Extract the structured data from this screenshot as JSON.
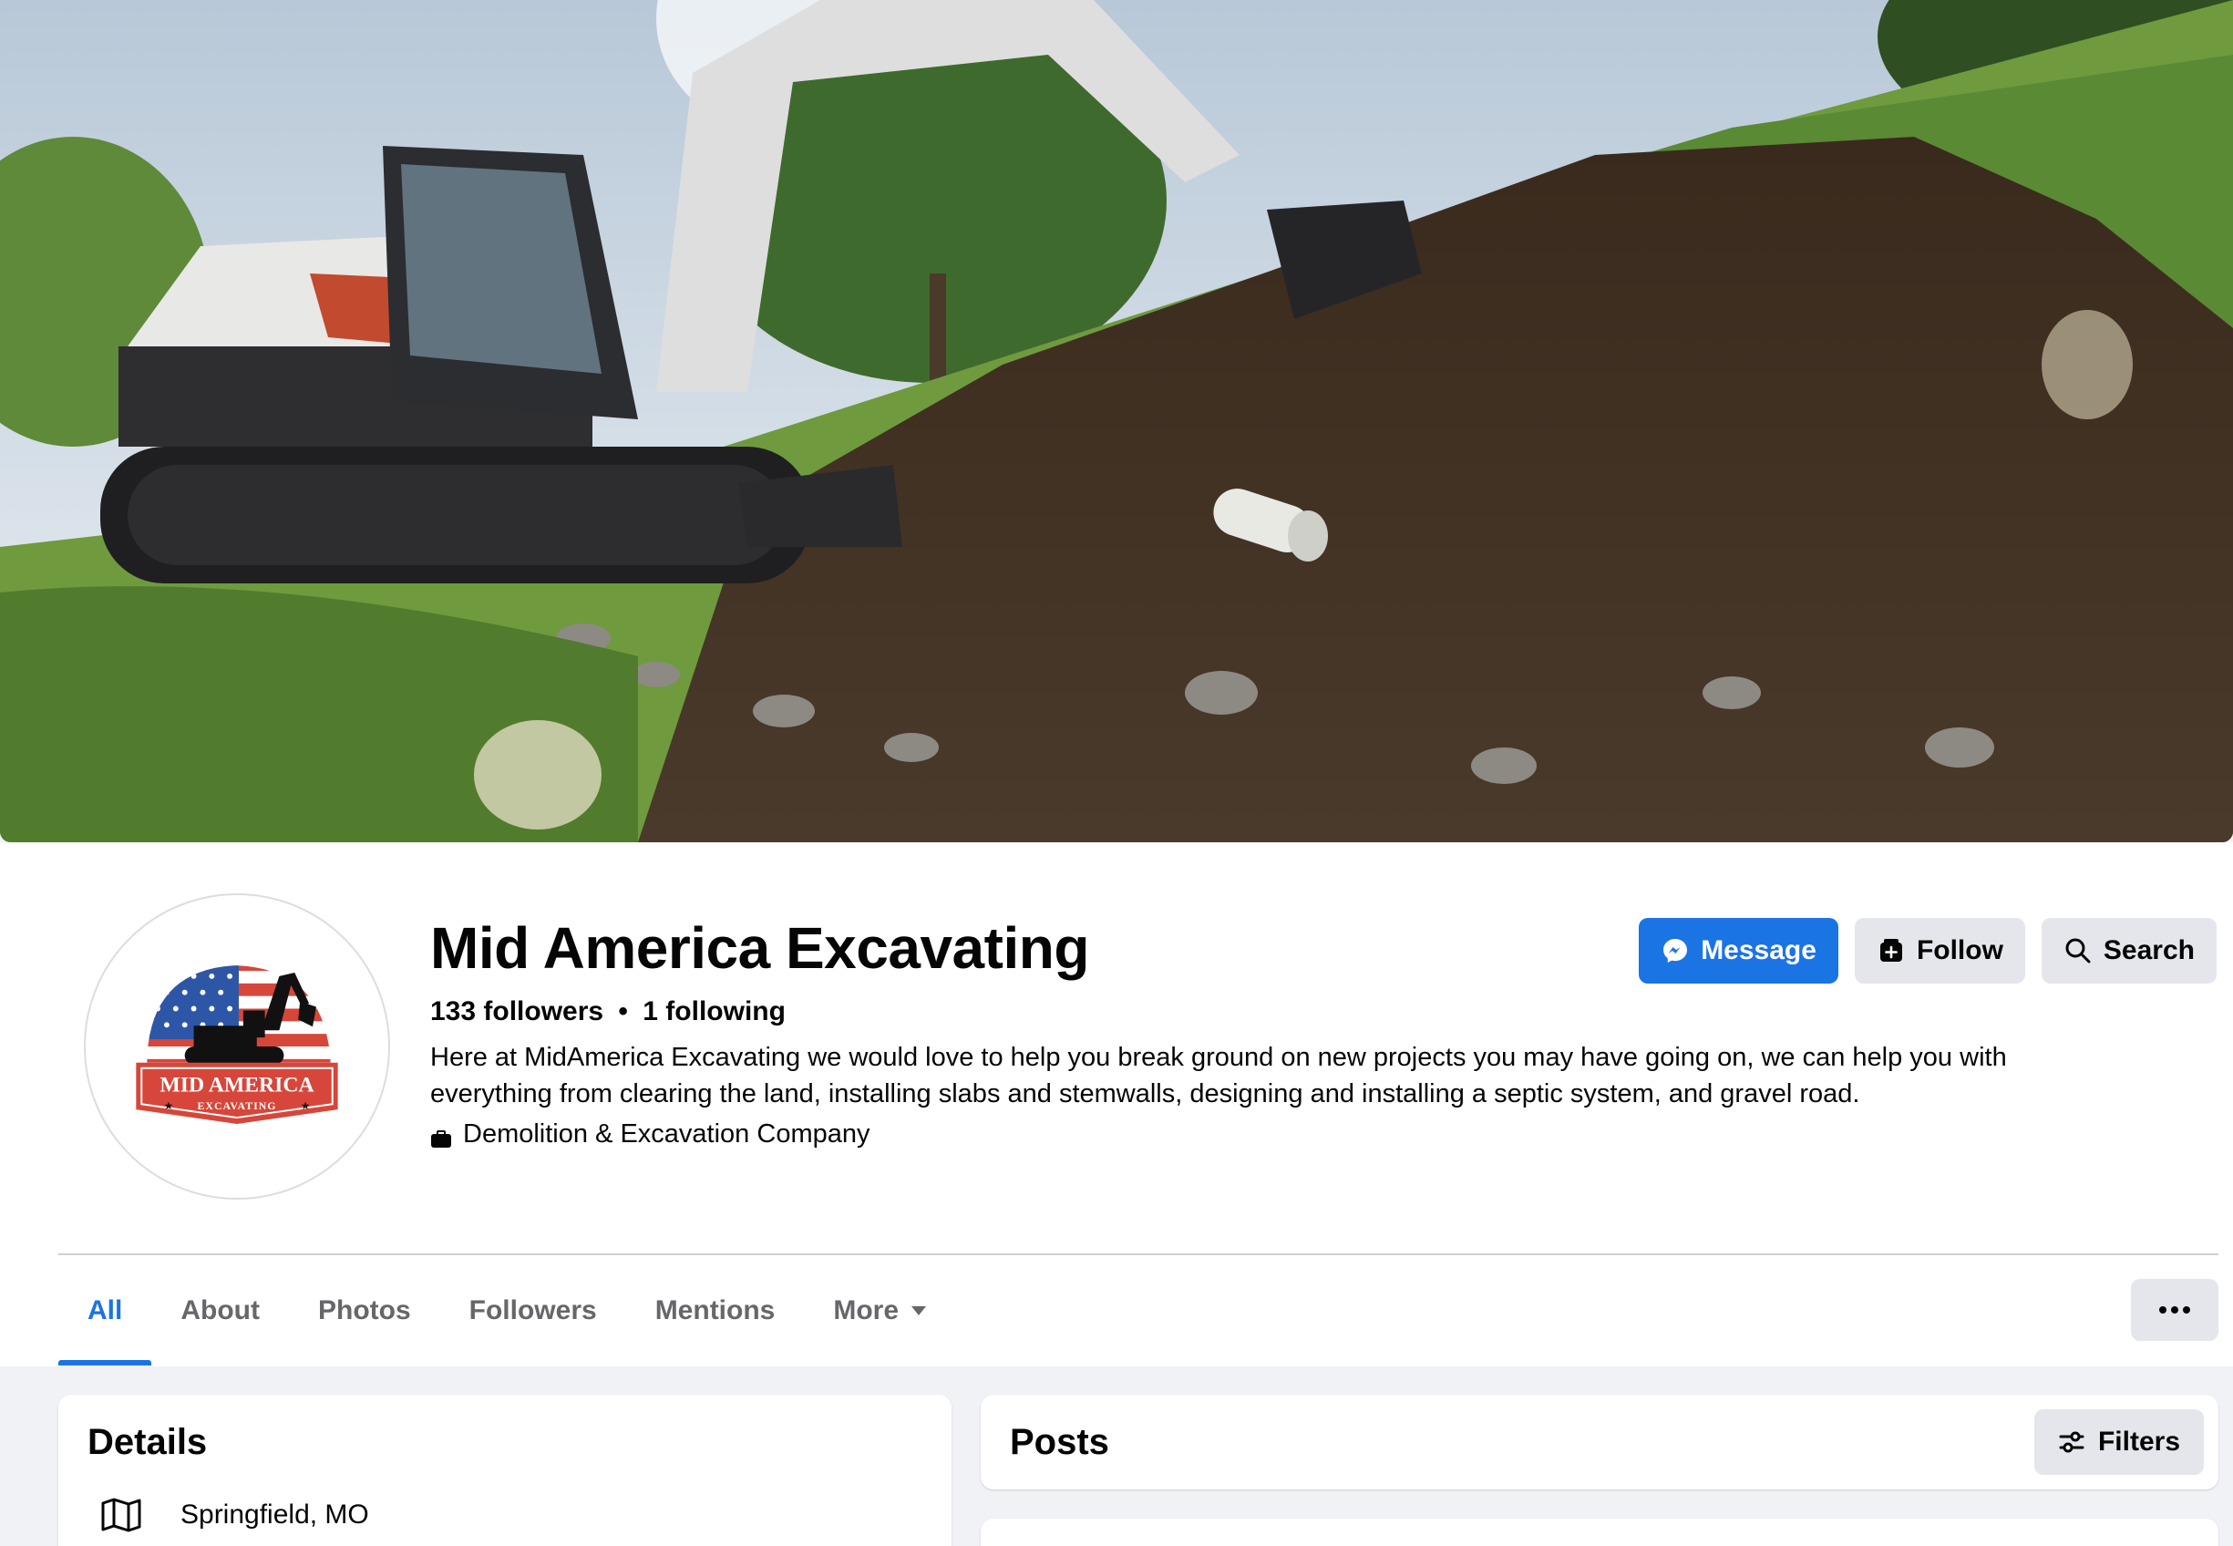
{
  "page": {
    "name": "Mid America Excavating",
    "followers": "133 followers",
    "following": "1 following",
    "separator": "•",
    "bio": "Here at MidAmerica Excavating we would love to help you break ground on new projects you may have going on, we can help you with everything from clearing the land, installing slabs and stemwalls, designing and installing a septic system, and gravel road.",
    "category": "Demolition & Excavation Company",
    "category_icon": "briefcase-icon"
  },
  "logo": {
    "line1": "MID AMERICA",
    "line2": "EXCAVATING"
  },
  "actions": {
    "message_label": "Message",
    "message_icon": "messenger-icon",
    "follow_label": "Follow",
    "follow_icon": "follow-icon",
    "search_label": "Search",
    "search_icon": "search-icon"
  },
  "tabs": [
    {
      "label": "All",
      "active": true
    },
    {
      "label": "About"
    },
    {
      "label": "Photos"
    },
    {
      "label": "Followers"
    },
    {
      "label": "Mentions"
    },
    {
      "label": "More",
      "has_caret": true
    }
  ],
  "details": {
    "title": "Details",
    "location": "Springfield, MO",
    "location_icon": "map-icon"
  },
  "posts": {
    "title": "Posts",
    "filters_label": "Filters",
    "filters_icon": "sliders-icon"
  },
  "colors": {
    "accent": "#1b74e4",
    "secondary_button": "#e4e6eb",
    "page_background": "#f0f2f5",
    "text_primary": "#050505",
    "text_secondary": "#65676b"
  }
}
